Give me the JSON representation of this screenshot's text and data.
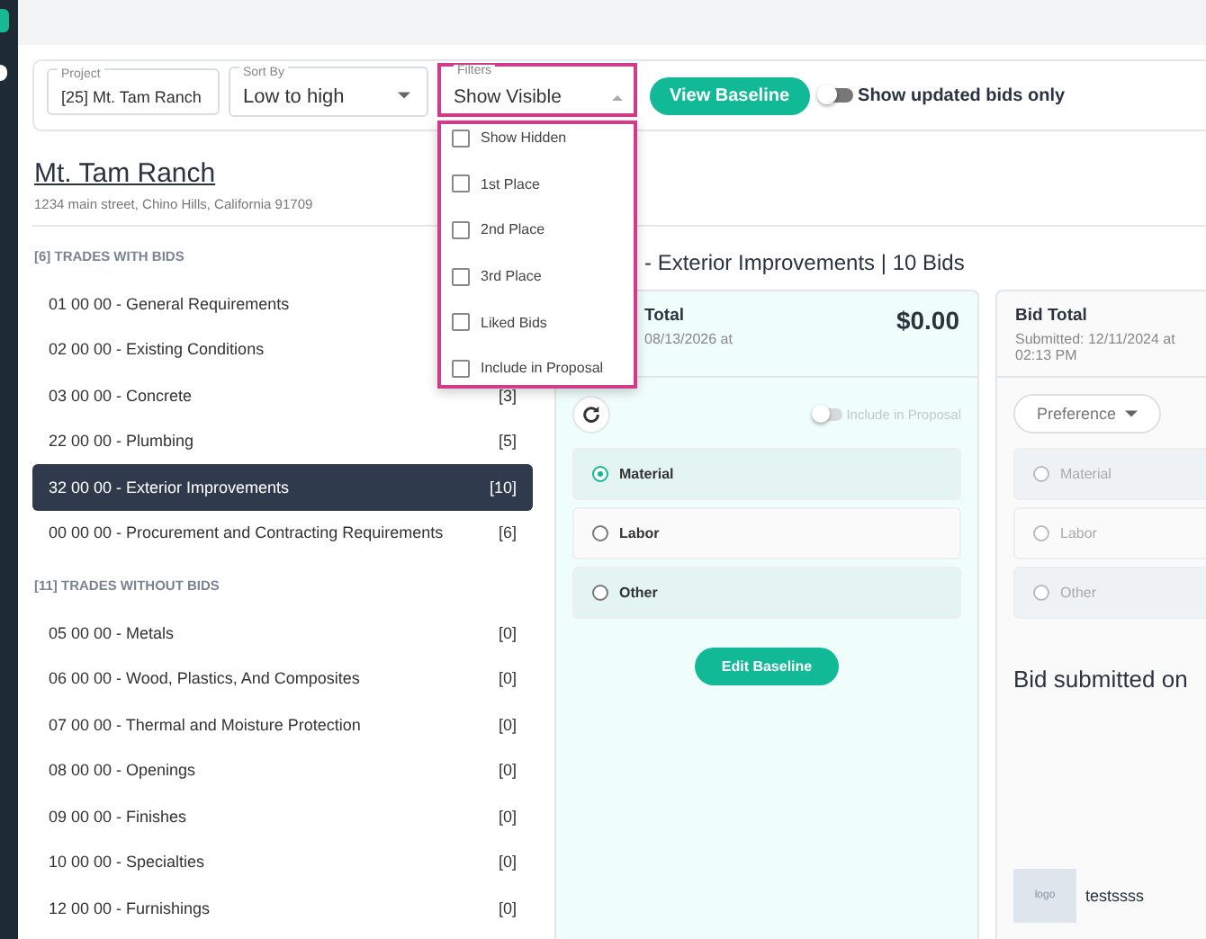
{
  "project_field": {
    "label": "Project",
    "value": "[25] Mt. Tam Ranch"
  },
  "sort_field": {
    "label": "Sort By",
    "value": "Low to high"
  },
  "filter_field": {
    "label": "Filters",
    "value": "Show Visible",
    "expanded": true,
    "options": [
      {
        "label": "Show Hidden",
        "checked": false
      },
      {
        "label": "1st Place",
        "checked": false
      },
      {
        "label": "2nd Place",
        "checked": false
      },
      {
        "label": "3rd Place",
        "checked": false
      },
      {
        "label": "Liked Bids",
        "checked": false
      },
      {
        "label": "Include in Proposal",
        "checked": false
      }
    ]
  },
  "view_baseline_button": "View Baseline",
  "updated_toggle": {
    "label": "Show updated bids only",
    "on": false
  },
  "project": {
    "title": "Mt. Tam Ranch",
    "address": "1234 main street, Chino Hills, California 91709"
  },
  "sections": [
    {
      "title": "[6] TRADES WITH BIDS",
      "items": [
        {
          "label": "01 00 00 - General Requirements",
          "selected": false
        },
        {
          "label": "02 00 00 - Existing Conditions",
          "selected": false
        },
        {
          "label": "03 00 00 - Concrete",
          "count": "[3]",
          "selected": false
        },
        {
          "label": "22 00 00 - Plumbing",
          "count": "[5]",
          "selected": false
        },
        {
          "label": "32 00 00 - Exterior Improvements",
          "count": "[10]",
          "selected": true
        },
        {
          "label": "00 00 00 - Procurement and Contracting Requirements",
          "count": "[6]",
          "selected": false
        }
      ]
    },
    {
      "title": "[11] TRADES WITHOUT BIDS",
      "items": [
        {
          "label": "05 00 00 - Metals",
          "count": "[0]",
          "selected": false
        },
        {
          "label": "06 00 00 - Wood, Plastics, And Composites",
          "count": "[0]",
          "selected": false
        },
        {
          "label": "07 00 00 - Thermal and Moisture Protection",
          "count": "[0]",
          "selected": false
        },
        {
          "label": "08 00 00 - Openings",
          "count": "[0]",
          "selected": false
        },
        {
          "label": "09 00 00 - Finishes",
          "count": "[0]",
          "selected": false
        },
        {
          "label": "10 00 00 - Specialties",
          "count": "[0]",
          "selected": false
        },
        {
          "label": "12 00 00 - Furnishings",
          "count": "[0]",
          "selected": false
        }
      ]
    }
  ],
  "trade_heading": "- Exterior Improvements | 10 Bids",
  "cards": [
    {
      "kind": "baseline",
      "title": "Total",
      "amount": "$0.00",
      "date": "08/13/2026 at",
      "include_toggle": {
        "label": "Include in Proposal",
        "on": false,
        "disabled": true
      },
      "options": [
        {
          "label": "Material",
          "selected": true,
          "disabled": false
        },
        {
          "label": "Labor",
          "selected": false,
          "disabled": false
        },
        {
          "label": "Other",
          "selected": false,
          "disabled": false
        }
      ],
      "button": "Edit Baseline"
    },
    {
      "kind": "bid",
      "title": "Bid Total",
      "date": "Submitted: 12/11/2024 at 02:13 PM",
      "preference": "Preference",
      "options": [
        {
          "label": "Material",
          "selected": false,
          "disabled": true
        },
        {
          "label": "Labor",
          "selected": false,
          "disabled": true
        },
        {
          "label": "Other",
          "selected": false,
          "disabled": true
        }
      ],
      "message": "Bid submitted on",
      "vendor": {
        "logo": "logo",
        "name": "testssss"
      }
    }
  ]
}
